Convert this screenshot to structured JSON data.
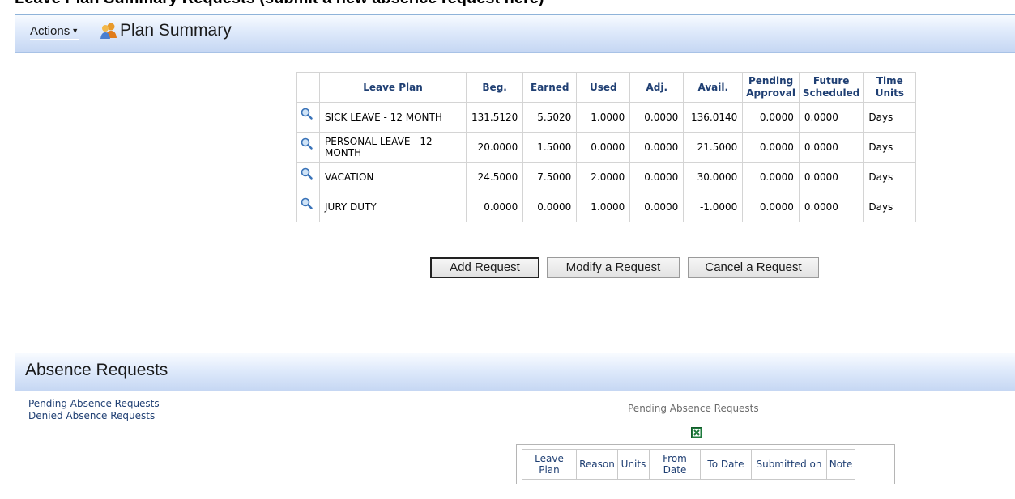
{
  "top_fragment": "Leave Plan Summary Requests (submit a new absence request here)",
  "plan_summary": {
    "actions_label": "Actions",
    "title": "Plan Summary",
    "columns": [
      "Leave Plan",
      "Beg.",
      "Earned",
      "Used",
      "Adj.",
      "Avail.",
      "Pending Approval",
      "Future Scheduled",
      "Time Units"
    ],
    "rows": [
      {
        "plan": "SICK LEAVE - 12 MONTH",
        "beg": "131.5120",
        "earned": "5.5020",
        "used": "1.0000",
        "adj": "0.0000",
        "avail": "136.0140",
        "pending": "0.0000",
        "future": "0.0000",
        "units": "Days"
      },
      {
        "plan": "PERSONAL LEAVE - 12 MONTH",
        "beg": "20.0000",
        "earned": "1.5000",
        "used": "0.0000",
        "adj": "0.0000",
        "avail": "21.5000",
        "pending": "0.0000",
        "future": "0.0000",
        "units": "Days"
      },
      {
        "plan": "VACATION",
        "beg": "24.5000",
        "earned": "7.5000",
        "used": "2.0000",
        "adj": "0.0000",
        "avail": "30.0000",
        "pending": "0.0000",
        "future": "0.0000",
        "units": "Days"
      },
      {
        "plan": "JURY DUTY",
        "beg": "0.0000",
        "earned": "0.0000",
        "used": "1.0000",
        "adj": "0.0000",
        "avail": "-1.0000",
        "pending": "0.0000",
        "future": "0.0000",
        "units": "Days"
      }
    ],
    "buttons": {
      "add": "Add Request",
      "modify": "Modify a Request",
      "cancel": "Cancel a Request"
    }
  },
  "absence_requests": {
    "title": "Absence Requests",
    "links": {
      "pending": "Pending Absence Requests",
      "denied": "Denied Absence Requests"
    },
    "table_caption": "Pending Absence Requests",
    "columns": {
      "leave_plan": "Leave Plan",
      "reason": "Reason",
      "units": "Units",
      "from_date": "From Date",
      "to_date": "To Date",
      "submitted_on": "Submitted on",
      "note": "Note"
    }
  },
  "icons": {
    "actions_caret": "caret-down-icon",
    "plan_summary": "people-icon",
    "row_detail": "magnifier-icon",
    "export": "excel-icon"
  },
  "colors": {
    "header_text": "#1f3f73",
    "panel_border": "#8fb3d9",
    "header_gradient_end": "#c6d7f3"
  }
}
